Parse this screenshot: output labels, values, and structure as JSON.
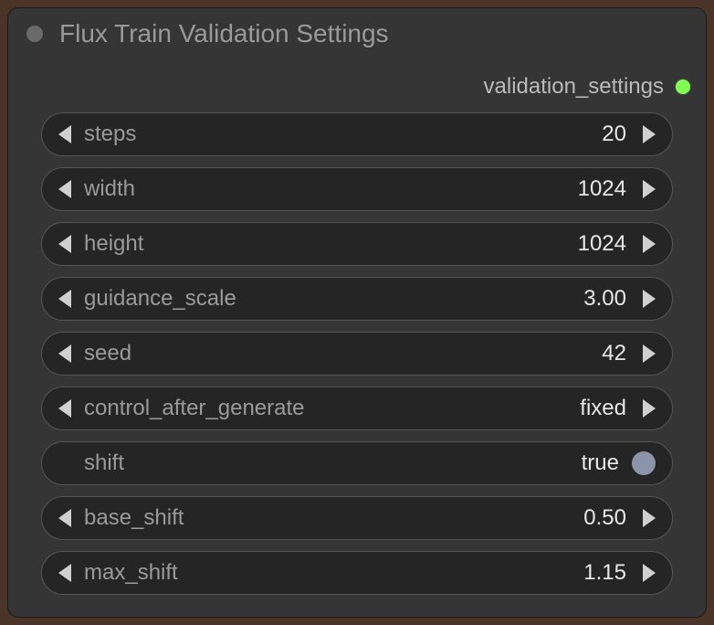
{
  "node": {
    "title": "Flux Train Validation Settings",
    "output": {
      "label": "validation_settings"
    },
    "params": {
      "steps": {
        "label": "steps",
        "value": "20"
      },
      "width": {
        "label": "width",
        "value": "1024"
      },
      "height": {
        "label": "height",
        "value": "1024"
      },
      "guidance_scale": {
        "label": "guidance_scale",
        "value": "3.00"
      },
      "seed": {
        "label": "seed",
        "value": "42"
      },
      "control_after_generate": {
        "label": "control_after_generate",
        "value": "fixed"
      },
      "shift": {
        "label": "shift",
        "value": "true"
      },
      "base_shift": {
        "label": "base_shift",
        "value": "0.50"
      },
      "max_shift": {
        "label": "max_shift",
        "value": "1.15"
      }
    }
  }
}
